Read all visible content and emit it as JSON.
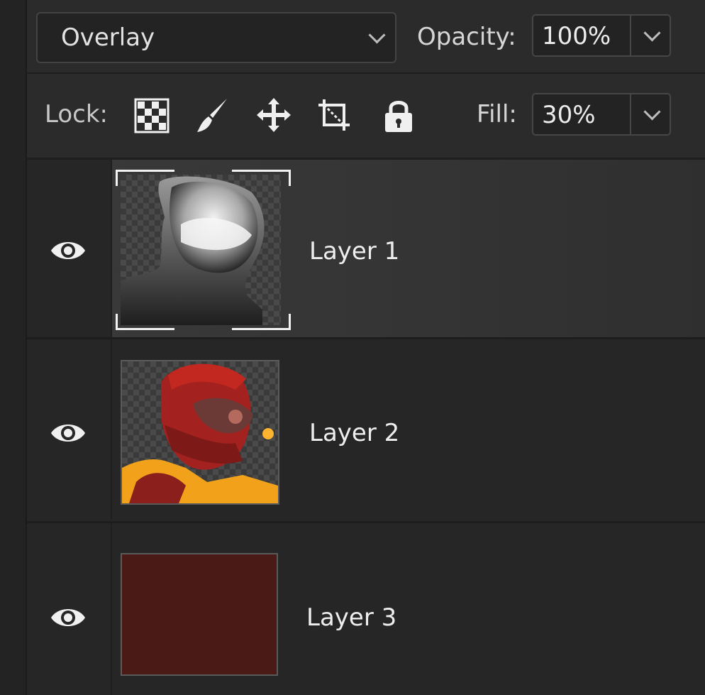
{
  "blend_mode": {
    "value": "Overlay"
  },
  "opacity": {
    "label": "Opacity:",
    "value": "100%"
  },
  "lock": {
    "label": "Lock:",
    "icons": [
      "lock-transparent-pixels-icon",
      "lock-image-pixels-icon",
      "lock-position-icon",
      "lock-artboard-icon",
      "lock-all-icon"
    ]
  },
  "fill": {
    "label": "Fill:",
    "value": "30%"
  },
  "layers": [
    {
      "name": "Layer 1",
      "visible": true,
      "selected": true,
      "thumbnail": "grayscale head mask on transparency"
    },
    {
      "name": "Layer 2",
      "visible": true,
      "selected": false,
      "thumbnail": "red armored helmet with yellow collar on transparency"
    },
    {
      "name": "Layer 3",
      "visible": true,
      "selected": false,
      "thumbnail": "solid dark red fill"
    }
  ],
  "colors": {
    "panel_bg": "#282828",
    "selected_row": "#383838",
    "layer3_fill": "#4a1a17",
    "text": "#e2e2e2"
  }
}
